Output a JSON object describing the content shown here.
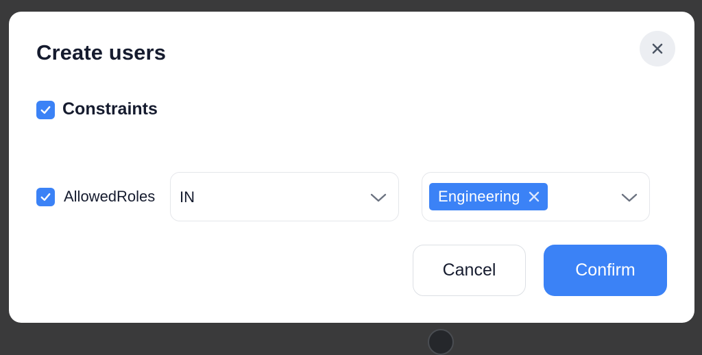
{
  "dialog": {
    "title": "Create users",
    "close_icon": "close-icon"
  },
  "constraints": {
    "label": "Constraints",
    "checked": true
  },
  "rule": {
    "field_label": "AllowedRoles",
    "checked": true,
    "operator": "IN",
    "values": [
      {
        "label": "Engineering"
      }
    ]
  },
  "actions": {
    "cancel_label": "Cancel",
    "confirm_label": "Confirm"
  },
  "colors": {
    "accent": "#3b82f6",
    "text": "#151b2e",
    "backdrop": "#3a3a3b"
  }
}
